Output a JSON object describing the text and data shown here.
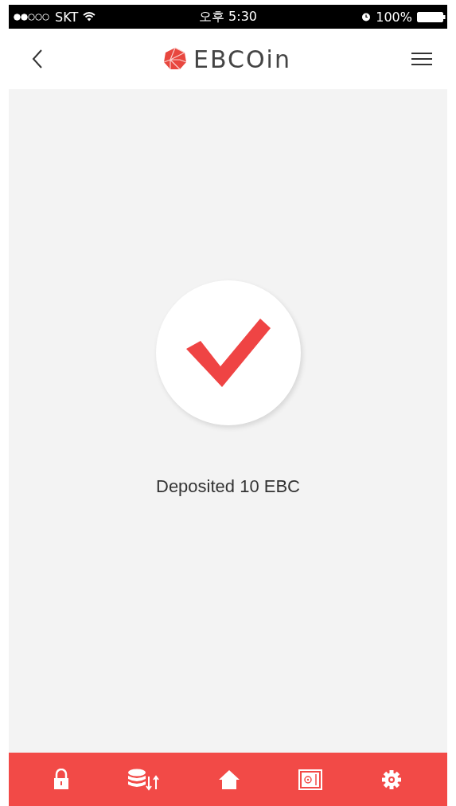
{
  "status_bar": {
    "carrier": "SKT",
    "time": "오후 5:30",
    "battery": "100%"
  },
  "nav_bar": {
    "logo": "EBCOin"
  },
  "result": {
    "success": true,
    "message": "Deposited 10 EBC"
  },
  "tab_bar": [
    {
      "kind": "lock"
    },
    {
      "kind": "transfer"
    },
    {
      "kind": "home"
    },
    {
      "kind": "safe"
    },
    {
      "kind": "settings"
    }
  ]
}
